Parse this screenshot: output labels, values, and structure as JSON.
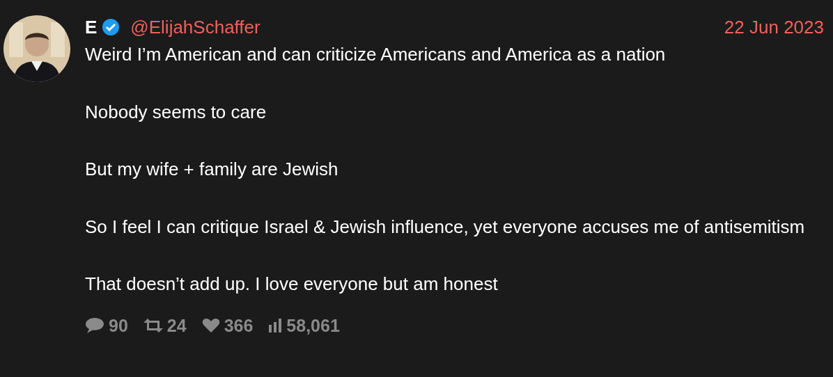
{
  "author": {
    "name": "E",
    "verified": true,
    "handle": "@ElijahSchaffer"
  },
  "date": "22 Jun 2023",
  "paragraphs": [
    "Weird I’m American and can criticize Americans and America as a nation",
    "Nobody seems to care",
    "But my wife + family are Jewish",
    "So I feel I can critique Israel & Jewish influence, yet everyone accuses me of antisemitism",
    "That doesn’t add up. I love everyone but am honest"
  ],
  "stats": [
    {
      "kind": "replies",
      "value": "90"
    },
    {
      "kind": "retweets",
      "value": "24"
    },
    {
      "kind": "likes",
      "value": "366"
    },
    {
      "kind": "views",
      "value": "58,061"
    }
  ]
}
